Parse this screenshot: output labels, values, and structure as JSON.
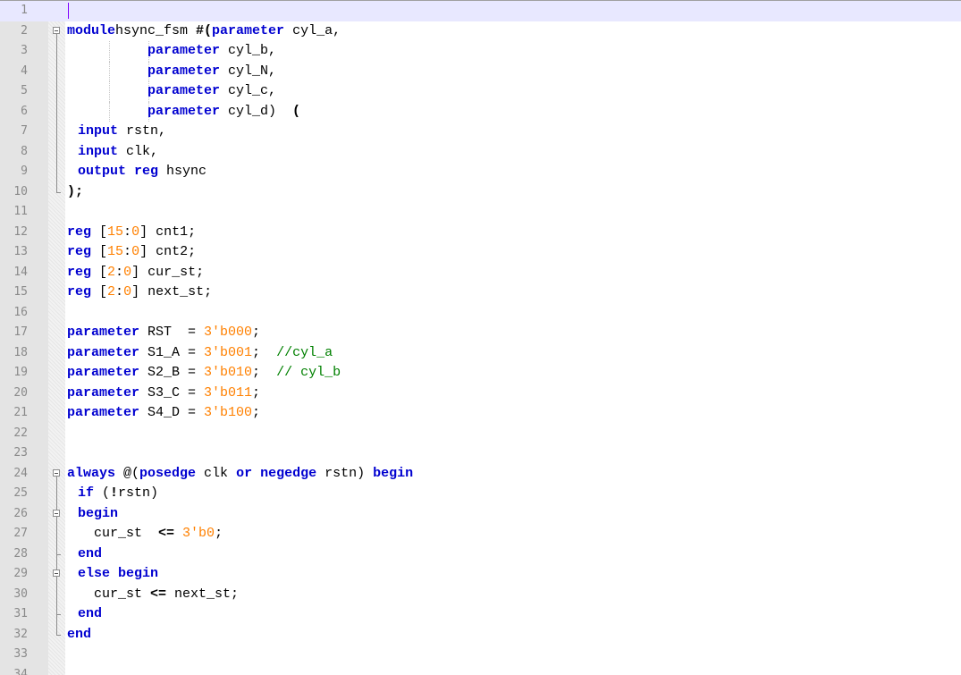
{
  "editor": {
    "language": "Verilog",
    "current_line": 1,
    "colors": {
      "keyword": "#0000d0",
      "number": "#ff8000",
      "comment": "#008000",
      "default": "#000000",
      "current_line_bg": "#e8e8ff",
      "gutter_bg": "#e4e4e4"
    },
    "lines": [
      {
        "n": "1",
        "t": []
      },
      {
        "n": "2",
        "t": [
          [
            "kw",
            "module"
          ],
          [
            "",
            "hsync_fsm "
          ],
          [
            "op",
            "#("
          ],
          [
            "kw",
            "parameter"
          ],
          [
            "",
            " cyl_a,"
          ]
        ]
      },
      {
        "n": "3",
        "t": [
          [
            "",
            "          "
          ],
          [
            "kw",
            "parameter"
          ],
          [
            "",
            " cyl_b,"
          ]
        ]
      },
      {
        "n": "4",
        "t": [
          [
            "",
            "          "
          ],
          [
            "kw",
            "parameter"
          ],
          [
            "",
            " cyl_N,"
          ]
        ]
      },
      {
        "n": "5",
        "t": [
          [
            "",
            "          "
          ],
          [
            "kw",
            "parameter"
          ],
          [
            "",
            " cyl_c,"
          ]
        ]
      },
      {
        "n": "6",
        "t": [
          [
            "",
            "          "
          ],
          [
            "kw",
            "parameter"
          ],
          [
            "",
            " cyl_d)  "
          ],
          [
            "op",
            "("
          ]
        ]
      },
      {
        "n": "7",
        "t": [
          [
            "",
            ""
          ],
          [
            "kw",
            "input"
          ],
          [
            "",
            " rstn,"
          ]
        ]
      },
      {
        "n": "8",
        "t": [
          [
            "",
            ""
          ],
          [
            "kw",
            "input"
          ],
          [
            "",
            " clk,"
          ]
        ]
      },
      {
        "n": "9",
        "t": [
          [
            "",
            ""
          ],
          [
            "kw",
            "output reg"
          ],
          [
            "",
            " hsync"
          ]
        ]
      },
      {
        "n": "10",
        "t": [
          [
            "op",
            ");"
          ]
        ]
      },
      {
        "n": "11",
        "t": []
      },
      {
        "n": "12",
        "t": [
          [
            "kw",
            "reg"
          ],
          [
            "",
            " ["
          ],
          [
            "num",
            "15"
          ],
          [
            "",
            ":"
          ],
          [
            "num",
            "0"
          ],
          [
            "",
            "] cnt1;"
          ]
        ]
      },
      {
        "n": "13",
        "t": [
          [
            "kw",
            "reg"
          ],
          [
            "",
            " ["
          ],
          [
            "num",
            "15"
          ],
          [
            "",
            ":"
          ],
          [
            "num",
            "0"
          ],
          [
            "",
            "] cnt2;"
          ]
        ]
      },
      {
        "n": "14",
        "t": [
          [
            "kw",
            "reg"
          ],
          [
            "",
            " ["
          ],
          [
            "num",
            "2"
          ],
          [
            "",
            ":"
          ],
          [
            "num",
            "0"
          ],
          [
            "",
            "] cur_st;"
          ]
        ]
      },
      {
        "n": "15",
        "t": [
          [
            "kw",
            "reg"
          ],
          [
            "",
            " ["
          ],
          [
            "num",
            "2"
          ],
          [
            "",
            ":"
          ],
          [
            "num",
            "0"
          ],
          [
            "",
            "] next_st;"
          ]
        ]
      },
      {
        "n": "16",
        "t": []
      },
      {
        "n": "17",
        "t": [
          [
            "kw",
            "parameter"
          ],
          [
            "",
            " RST  = "
          ],
          [
            "num",
            "3'b000"
          ],
          [
            "",
            ";"
          ]
        ]
      },
      {
        "n": "18",
        "t": [
          [
            "kw",
            "parameter"
          ],
          [
            "",
            " S1_A = "
          ],
          [
            "num",
            "3'b001"
          ],
          [
            "",
            ";  "
          ],
          [
            "cmt",
            "//cyl_a"
          ]
        ]
      },
      {
        "n": "19",
        "t": [
          [
            "kw",
            "parameter"
          ],
          [
            "",
            " S2_B = "
          ],
          [
            "num",
            "3'b010"
          ],
          [
            "",
            ";  "
          ],
          [
            "cmt",
            "// cyl_b"
          ]
        ]
      },
      {
        "n": "20",
        "t": [
          [
            "kw",
            "parameter"
          ],
          [
            "",
            " S3_C = "
          ],
          [
            "num",
            "3'b011"
          ],
          [
            "",
            ";"
          ]
        ]
      },
      {
        "n": "21",
        "t": [
          [
            "kw",
            "parameter"
          ],
          [
            "",
            " S4_D = "
          ],
          [
            "num",
            "3'b100"
          ],
          [
            "",
            ";"
          ]
        ]
      },
      {
        "n": "22",
        "t": []
      },
      {
        "n": "23",
        "t": []
      },
      {
        "n": "24",
        "t": [
          [
            "kw",
            "always"
          ],
          [
            "",
            " @("
          ],
          [
            "kw",
            "posedge"
          ],
          [
            "",
            " clk "
          ],
          [
            "kw",
            "or"
          ],
          [
            "",
            " "
          ],
          [
            "kw",
            "negedge"
          ],
          [
            "",
            " rstn) "
          ],
          [
            "kw",
            "begin"
          ]
        ]
      },
      {
        "n": "25",
        "t": [
          [
            "",
            ""
          ],
          [
            "kw",
            "if"
          ],
          [
            "",
            " ("
          ],
          [
            "op",
            "!"
          ],
          [
            "",
            "rstn)"
          ]
        ]
      },
      {
        "n": "26",
        "t": [
          [
            "",
            ""
          ],
          [
            "kw",
            "begin"
          ]
        ]
      },
      {
        "n": "27",
        "t": [
          [
            "",
            "  cur_st  "
          ],
          [
            "op",
            "<="
          ],
          [
            "",
            " "
          ],
          [
            "num",
            "3'b0"
          ],
          [
            "",
            ";"
          ]
        ]
      },
      {
        "n": "28",
        "t": [
          [
            "",
            ""
          ],
          [
            "kw",
            "end"
          ]
        ]
      },
      {
        "n": "29",
        "t": [
          [
            "",
            ""
          ],
          [
            "kw",
            "else begin"
          ]
        ]
      },
      {
        "n": "30",
        "t": [
          [
            "",
            "  cur_st "
          ],
          [
            "op",
            "<="
          ],
          [
            "",
            " next_st;"
          ]
        ]
      },
      {
        "n": "31",
        "t": [
          [
            "",
            ""
          ],
          [
            "kw",
            "end"
          ]
        ]
      },
      {
        "n": "32",
        "t": [
          [
            "kw",
            "end"
          ]
        ]
      },
      {
        "n": "33",
        "t": []
      },
      {
        "n": "34",
        "t": []
      }
    ]
  }
}
